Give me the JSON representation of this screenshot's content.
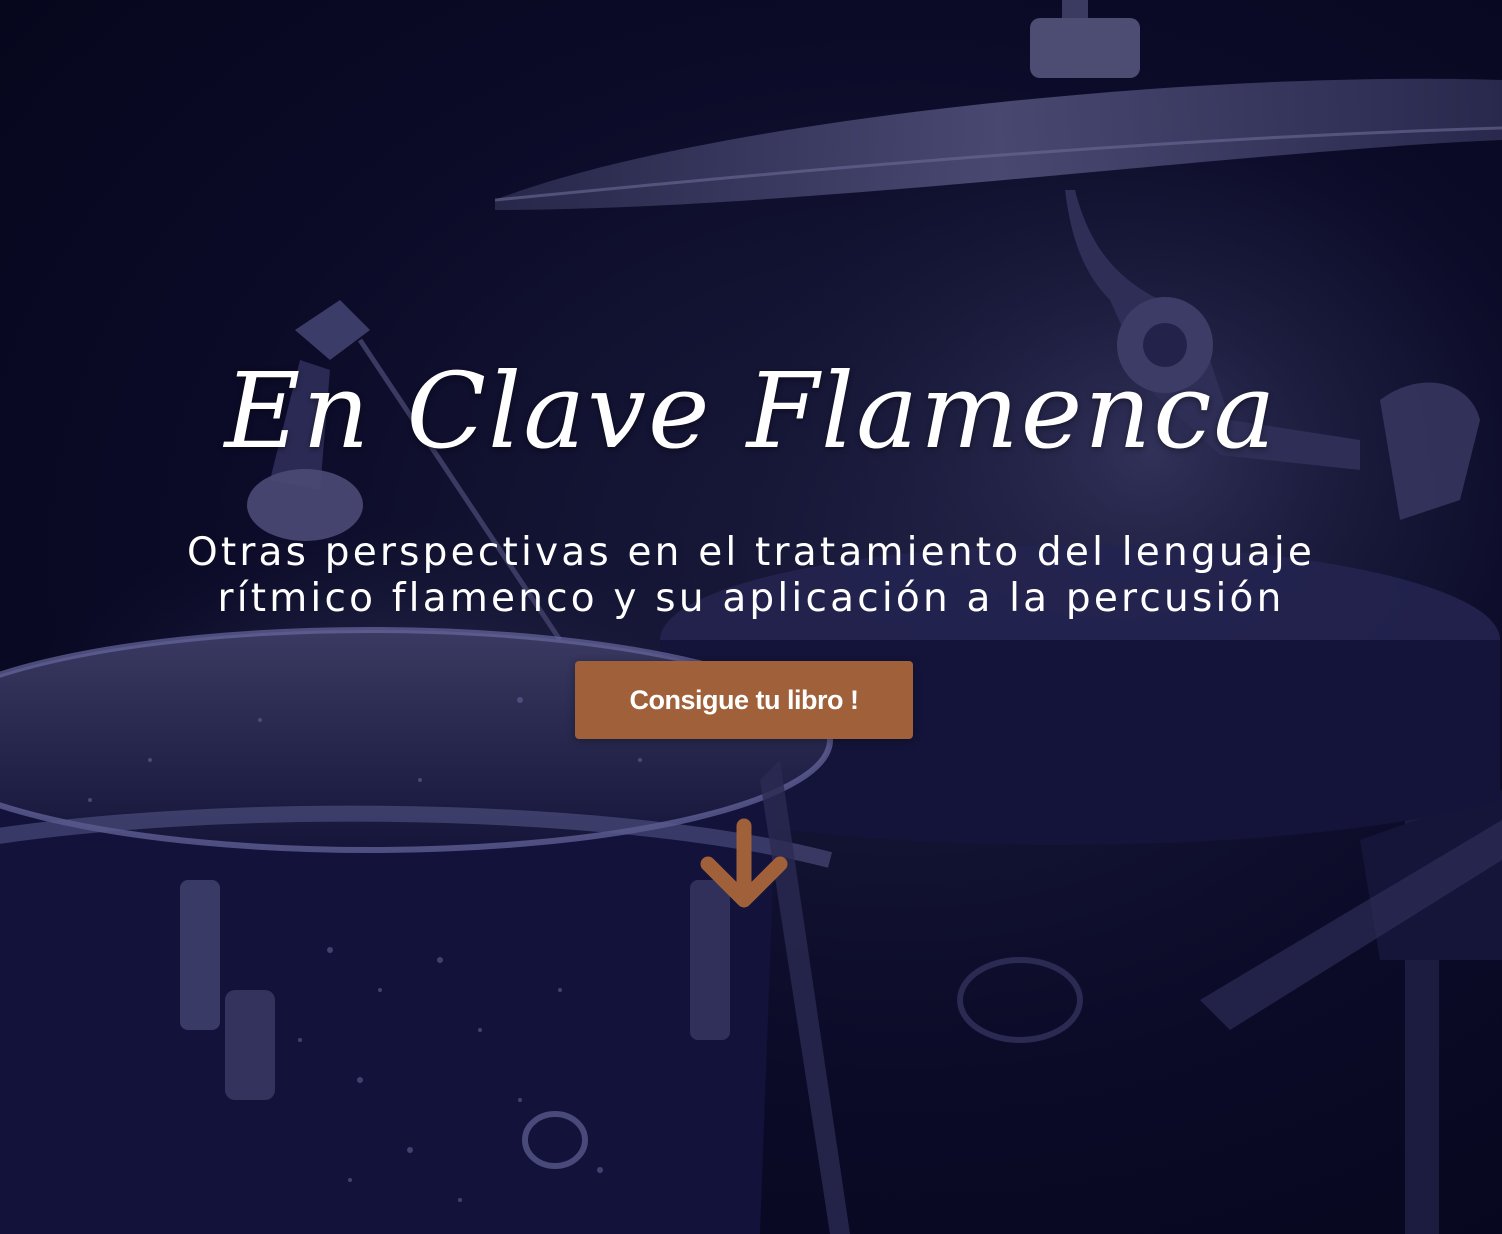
{
  "hero": {
    "title": "En Clave Flamenca",
    "subtitle_line1": "Otras perspectivas en el tratamiento del lenguaje",
    "subtitle_line2": "rítmico flamenco y su aplicación a la percusión",
    "cta_label": "Consigue tu libro !",
    "scroll_icon": "arrow-down-icon",
    "background": "drum-kit-photo"
  },
  "colors": {
    "overlay": "#0b0b28",
    "accent": "#a0603a",
    "text": "#ffffff"
  }
}
